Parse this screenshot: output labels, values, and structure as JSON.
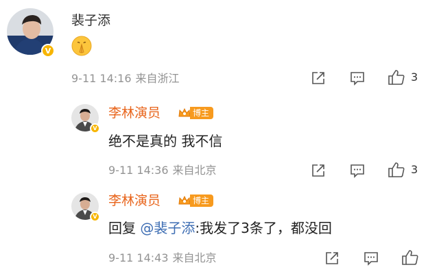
{
  "comments": [
    {
      "username": "裴子添",
      "text": "",
      "emoji": "praying-hands-emoji",
      "time": "9-11 14:16",
      "source": "来自浙江",
      "likes": "3",
      "verified": true
    },
    {
      "username": "李林演员",
      "badge": "博主",
      "text": "绝不是真的 我不信",
      "time": "9-11 14:36",
      "source": "来自北京",
      "likes": "3",
      "verified": true
    },
    {
      "username": "李林演员",
      "badge": "博主",
      "reply_prefix": "回复",
      "mention": "@裴子添",
      "reply_text": ":我发了3条了，都没回",
      "time": "9-11 14:43",
      "source": "来自北京",
      "likes": "",
      "verified": true
    }
  ],
  "colors": {
    "author_name": "#333333",
    "blogger_name": "#e8641b",
    "mention": "#3d6db3",
    "badge": "#f79a1e",
    "meta": "#939393"
  },
  "icons": [
    "share-icon",
    "comment-icon",
    "like-icon",
    "verified-icon",
    "crown-icon"
  ]
}
